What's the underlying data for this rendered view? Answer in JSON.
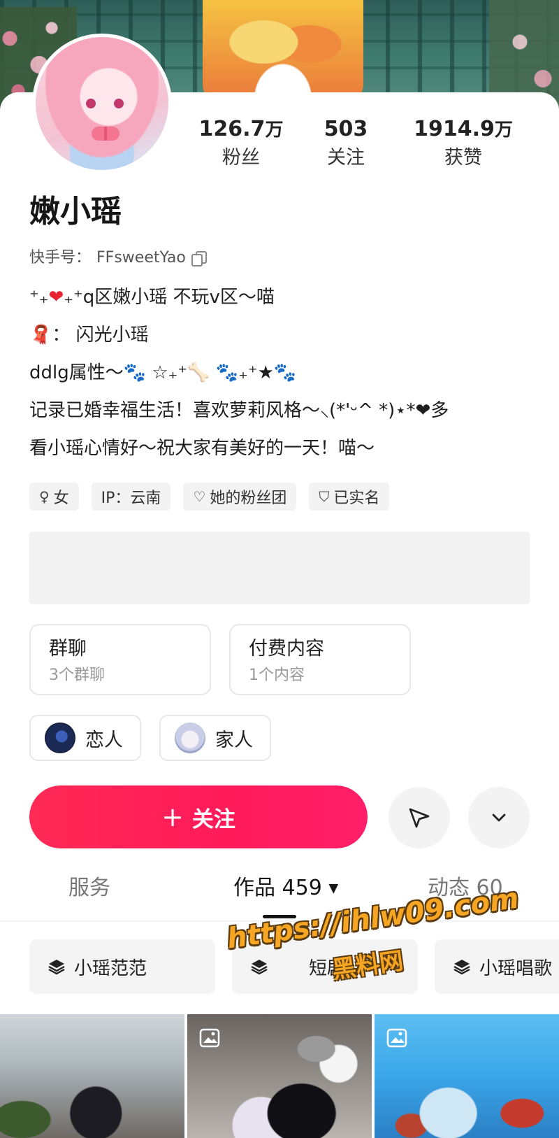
{
  "profile": {
    "name": "嫩小瑶",
    "kuaishou_id_label": "快手号：",
    "kuaishou_id": "FFsweetYao"
  },
  "stats": [
    {
      "value": "126.7",
      "unit": "万",
      "label": "粉丝"
    },
    {
      "value": "503",
      "unit": "",
      "label": "关注"
    },
    {
      "value": "1914.9",
      "unit": "万",
      "label": "获赞"
    }
  ],
  "bio": {
    "line1_prefix": "⁺₊",
    "line1_suffix": "₊⁺q区嫩小瑶 不玩v区～喵",
    "line2_icon": "🧣",
    "line2_text": "：  闪光小瑶",
    "line3": "ddlg属性～🐾 ☆₊⁺🦴 🐾₊⁺★🐾",
    "line4": "记录已婚幸福生活！喜欢萝莉风格～⸜(*'ᵕ^ *)⋆*❤多",
    "line5": "看小瑶心情好～祝大家有美好的一天！喵～"
  },
  "tags": [
    {
      "icon": "♀",
      "label": "女"
    },
    {
      "icon": "",
      "label": "IP：云南"
    },
    {
      "icon": "♡",
      "label": "她的粉丝团"
    },
    {
      "icon": "⛉",
      "label": "已实名"
    }
  ],
  "boxes": [
    {
      "title": "群聊",
      "sub": "3个群聊"
    },
    {
      "title": "付费内容",
      "sub": "1个内容"
    }
  ],
  "relations": [
    {
      "label": "恋人"
    },
    {
      "label": "家人"
    }
  ],
  "actions": {
    "follow_label": "关注",
    "follow_icon": "+"
  },
  "tabs": [
    {
      "label": "服务"
    },
    {
      "label": "作品 459",
      "caret": "▼"
    },
    {
      "label": "动态 60"
    }
  ],
  "collections": [
    {
      "label": "小瑶范范"
    },
    {
      "label": "短剧"
    },
    {
      "label": "小瑶唱歌"
    }
  ],
  "watermark": {
    "url": "https://ihlw09.com",
    "name": "黑料网"
  },
  "colors": {
    "accent": "#ff2a55",
    "heart": "#e8232f",
    "paw": "#3b82d6"
  }
}
